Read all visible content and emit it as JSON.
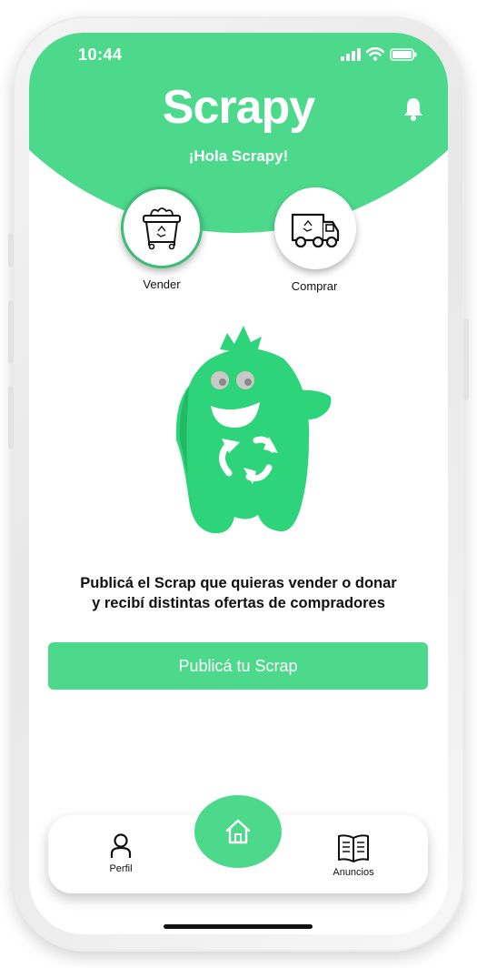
{
  "status_bar": {
    "time": "10:44"
  },
  "header": {
    "app_title": "Scrapy",
    "greeting": "¡Hola Scrapy!"
  },
  "actions": {
    "sell_label": "Vender",
    "buy_label": "Comprar"
  },
  "promo": {
    "line1": "Publicá el Scrap que quieras vender o donar",
    "line2": "y recibí distintas ofertas de compradores"
  },
  "cta": {
    "label": "Publicá tu Scrap"
  },
  "nav": {
    "profile_label": "Perfil",
    "ads_label": "Anuncios"
  },
  "icons": {
    "notifications": "bell-icon",
    "sell": "recycling-bin-icon",
    "buy": "recycling-truck-icon",
    "home": "home-icon",
    "profile": "user-icon",
    "ads": "open-book-icon"
  },
  "colors": {
    "brand_green": "#4dd98c",
    "mascot_green": "#2ed47a",
    "white": "#ffffff"
  }
}
